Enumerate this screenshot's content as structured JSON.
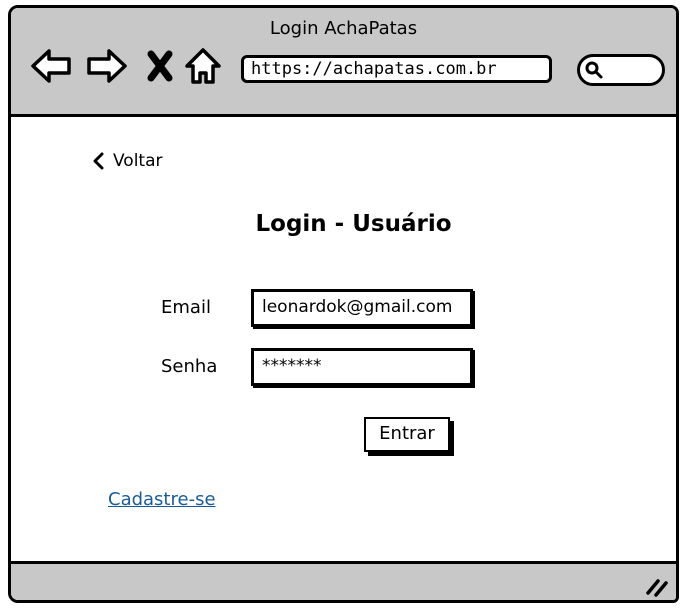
{
  "window": {
    "title": "Login AchaPatas"
  },
  "browser": {
    "url": "https://achapatas.com.br",
    "icons": {
      "back": "arrow-left-icon",
      "forward": "arrow-right-icon",
      "stop": "close-icon",
      "home": "home-icon",
      "search": "search-icon"
    }
  },
  "page": {
    "back_label": "Voltar",
    "title": "Login - Usuário",
    "email_label": "Email",
    "email_value": "leonardok@gmail.com",
    "password_label": "Senha",
    "password_value": "*******",
    "submit_label": "Entrar",
    "signup_label": "Cadastre-se"
  },
  "colors": {
    "chrome": "#c8c8c8",
    "link": "#1a5c9a"
  }
}
